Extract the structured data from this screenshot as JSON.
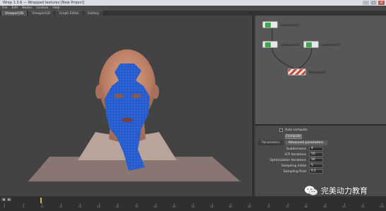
{
  "window": {
    "title": "Wrap 1.3.6 — Wrapped textures [New Project]",
    "buttons": [
      "–",
      "□",
      "×"
    ]
  },
  "menubar": [
    "File",
    "Edit",
    "Nodes",
    "License",
    "Help"
  ],
  "tabs": [
    "Viewport3D",
    "Viewport2D",
    "Graph Editor",
    "Gallery"
  ],
  "nodegraph": {
    "nodes": [
      {
        "label": "LoadGeom01",
        "color": "#3fa84a"
      },
      {
        "label": "LoadGeom02",
        "color": "#3fa84a"
      },
      {
        "label": "LoadGeom03",
        "color": "#3fa84a"
      },
      {
        "label": "Wrapping01",
        "color": "#c94a3a"
      }
    ]
  },
  "parameters": {
    "checkbox_label": "Auto compute",
    "compute_button": "Compute",
    "tabs": [
      "Parameters",
      "Advanced parameters"
    ],
    "rows": [
      {
        "label": "Subdivisions",
        "value": "4"
      },
      {
        "label": "ICP iterations",
        "value": "50"
      },
      {
        "label": "Optimization iterations",
        "value": "30"
      },
      {
        "label": "Sampling initial",
        "value": "5"
      },
      {
        "label": "Sampling final",
        "value": "0.1"
      }
    ]
  },
  "timeline": {
    "ticks": [
      "0",
      "5",
      "10",
      "15",
      "20",
      "25",
      "30",
      "35",
      "40",
      "45",
      "50",
      "55",
      "60",
      "65",
      "70",
      "75",
      "80",
      "85",
      "90",
      "95",
      "100"
    ]
  },
  "watermark": {
    "text": "完美动力教育"
  },
  "colors": {
    "mesh_blue": "#2b63d8",
    "skin": "#c98f72",
    "viewport_bg": "#434343",
    "wrap_node": "#c94a3a"
  }
}
